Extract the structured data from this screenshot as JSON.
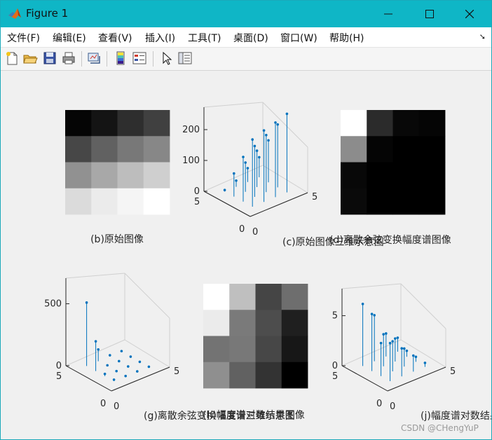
{
  "window": {
    "title": "Figure 1"
  },
  "menu": [
    {
      "key": "file",
      "label": "文件(F)"
    },
    {
      "key": "edit",
      "label": "编辑(E)"
    },
    {
      "key": "view",
      "label": "查看(V)"
    },
    {
      "key": "insert",
      "label": "插入(I)"
    },
    {
      "key": "tools",
      "label": "工具(T)"
    },
    {
      "key": "desktop",
      "label": "桌面(D)"
    },
    {
      "key": "window",
      "label": "窗口(W)"
    },
    {
      "key": "help",
      "label": "帮助(H)"
    }
  ],
  "toolbar": [
    "new-figure-icon",
    "open-icon",
    "save-icon",
    "print-icon",
    "link-plot-icon",
    "colorbar-icon",
    "legend-icon",
    "pointer-icon",
    "property-inspector-icon"
  ],
  "captions": {
    "b": "(b)原始图像",
    "c": "(c)原始图像三维示意图",
    "d": "(d)离散余弦变换幅度谱图像",
    "g": "(g)离散余弦变换幅度谱三维示意图",
    "h": "(h)幅度谱对数结果图像",
    "j": "(j)幅度谱对数结果三维示意图"
  },
  "watermark": "CSDN @CHengYuP",
  "chart_data": [
    {
      "id": "b",
      "type": "heatmap",
      "title": "(b)原始图像",
      "colormap": "gray",
      "values": [
        [
          0.02,
          0.08,
          0.18,
          0.25
        ],
        [
          0.28,
          0.38,
          0.47,
          0.53
        ],
        [
          0.57,
          0.66,
          0.74,
          0.81
        ],
        [
          0.86,
          0.92,
          0.96,
          1.0
        ]
      ]
    },
    {
      "id": "c",
      "type": "stem3",
      "title": "(c)原始图像三维示意图",
      "zticks": [
        "0",
        "100",
        "200"
      ],
      "zlim": [
        0,
        250
      ],
      "xticks": [
        "0",
        "5"
      ],
      "yticks": [
        "0",
        "5"
      ],
      "values": [
        [
          5,
          20,
          45,
          65
        ],
        [
          75,
          95,
          118,
          136
        ],
        [
          145,
          165,
          185,
          204
        ],
        [
          218,
          232,
          242,
          255
        ]
      ]
    },
    {
      "id": "d",
      "type": "heatmap",
      "title": "(d)离散余弦变换幅度谱图像",
      "colormap": "gray",
      "values": [
        [
          1.0,
          0.17,
          0.03,
          0.02
        ],
        [
          0.55,
          0.02,
          0.0,
          0.0
        ],
        [
          0.03,
          0.0,
          0.0,
          0.0
        ],
        [
          0.04,
          0.0,
          0.0,
          0.0
        ]
      ]
    },
    {
      "id": "g",
      "type": "stem3",
      "title": "(g)离散余弦变换幅度谱三维示意图",
      "zticks": [
        "0",
        "500"
      ],
      "zlim": [
        0,
        650
      ],
      "xticks": [
        "0",
        "5"
      ],
      "yticks": [
        "0",
        "5"
      ],
      "values": [
        [
          512,
          95,
          10,
          5
        ],
        [
          240,
          8,
          3,
          1
        ],
        [
          18,
          2,
          1,
          0
        ],
        [
          12,
          3,
          2,
          1
        ]
      ]
    },
    {
      "id": "h",
      "type": "heatmap",
      "title": "(h)幅度谱对数结果图像",
      "colormap": "gray",
      "values": [
        [
          1.0,
          0.75,
          0.27,
          0.43
        ],
        [
          0.92,
          0.48,
          0.3,
          0.12
        ],
        [
          0.45,
          0.47,
          0.28,
          0.09
        ],
        [
          0.56,
          0.38,
          0.2,
          0.0
        ]
      ]
    },
    {
      "id": "j",
      "type": "stem3",
      "title": "(j)幅度谱对数结果三维示意图",
      "zticks": [
        "0",
        "5"
      ],
      "zlim": [
        0,
        7
      ],
      "xticks": [
        "0",
        "5"
      ],
      "yticks": [
        "0",
        "5"
      ],
      "values": [
        [
          6.2,
          4.6,
          2.3,
          1.4
        ],
        [
          5.7,
          3.2,
          2.3,
          0.6
        ],
        [
          3.3,
          3.0,
          1.8,
          0.5
        ],
        [
          3.8,
          2.8,
          1.6,
          0.4
        ]
      ]
    }
  ]
}
